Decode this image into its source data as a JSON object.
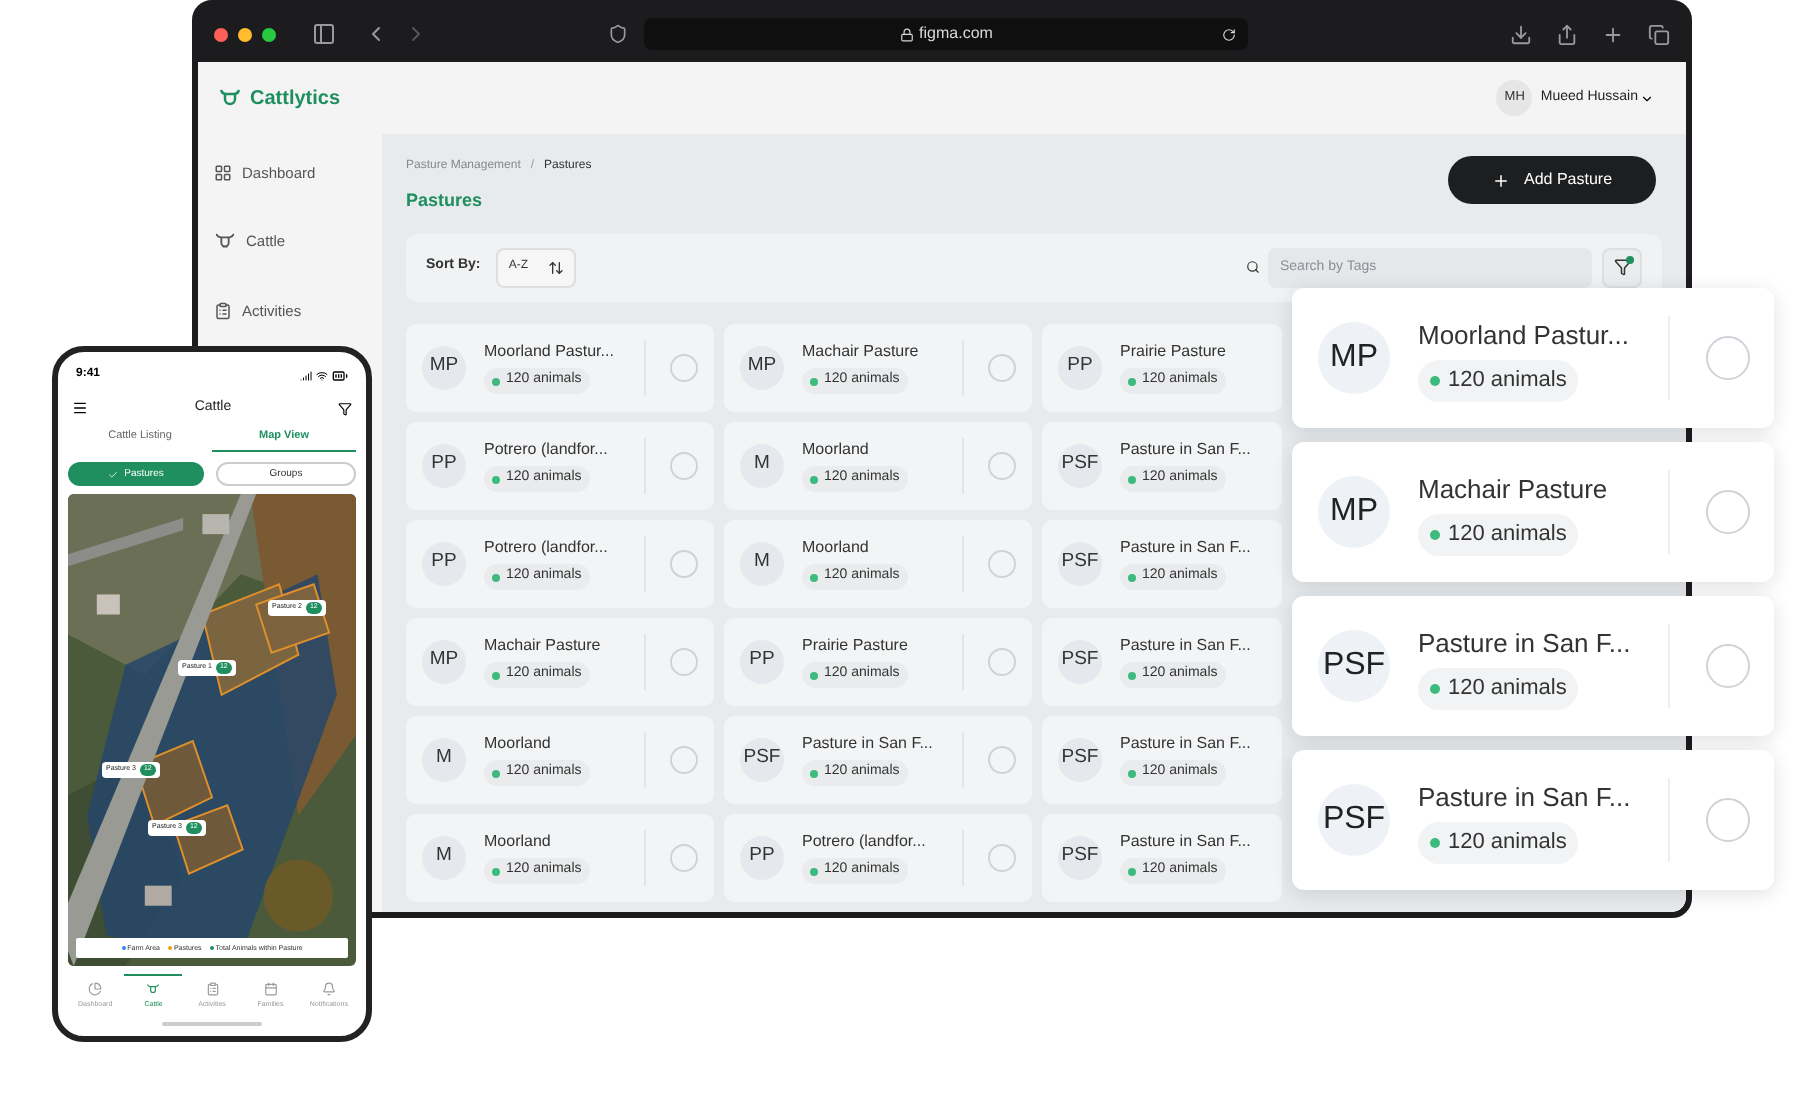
{
  "browser": {
    "url": "figma.com"
  },
  "app": {
    "brand": "Cattlytics",
    "user": {
      "initials": "MH",
      "name": "Mueed Hussain"
    },
    "sidebar": [
      {
        "label": "Dashboard"
      },
      {
        "label": "Cattle"
      },
      {
        "label": "Activities"
      }
    ],
    "breadcrumb": [
      "Pasture Management",
      "Pastures"
    ],
    "breadcrumb_separator": "/",
    "title": "Pastures",
    "add_button": "Add Pasture",
    "sort": {
      "label": "Sort By:",
      "value": "A-Z"
    },
    "search": {
      "placeholder": "Search by Tags"
    },
    "pastures": [
      {
        "initials": "MP",
        "name": "Moorland Pastur...",
        "count": "120 animals",
        "selected": false
      },
      {
        "initials": "MP",
        "name": "Machair Pasture",
        "count": "120 animals",
        "selected": false
      },
      {
        "initials": "PP",
        "name": "Prairie Pasture",
        "count": "120 animals"
      },
      {
        "initials": "PP",
        "name": "Potrero (landfor...",
        "count": "120 animals",
        "selected": false
      },
      {
        "initials": "M",
        "name": "Moorland",
        "count": "120 animals",
        "selected": false
      },
      {
        "initials": "PSF",
        "name": "Pasture in San F...",
        "count": "120 animals"
      },
      {
        "initials": "PP",
        "name": "Potrero (landfor...",
        "count": "120 animals",
        "selected": false
      },
      {
        "initials": "M",
        "name": "Moorland",
        "count": "120 animals",
        "selected": false
      },
      {
        "initials": "PSF",
        "name": "Pasture in San F...",
        "count": "120 animals"
      },
      {
        "initials": "MP",
        "name": "Machair Pasture",
        "count": "120 animals",
        "selected": false
      },
      {
        "initials": "PP",
        "name": "Prairie Pasture",
        "count": "120 animals",
        "selected": false
      },
      {
        "initials": "PSF",
        "name": "Pasture in San F...",
        "count": "120 animals"
      },
      {
        "initials": "M",
        "name": "Moorland",
        "count": "120 animals",
        "selected": false
      },
      {
        "initials": "PSF",
        "name": "Pasture in San F...",
        "count": "120 animals",
        "selected": false
      },
      {
        "initials": "PSF",
        "name": "Pasture in San F...",
        "count": "120 animals"
      },
      {
        "initials": "M",
        "name": "Moorland",
        "count": "120 animals",
        "selected": false
      },
      {
        "initials": "PP",
        "name": "Potrero (landfor...",
        "count": "120 animals",
        "selected": false
      },
      {
        "initials": "PSF",
        "name": "Pasture in San F...",
        "count": "120 animals"
      }
    ]
  },
  "floating_cards": [
    {
      "initials": "MP",
      "name": "Moorland Pastur...",
      "count": "120 animals",
      "selected": false
    },
    {
      "initials": "MP",
      "name": "Machair Pasture",
      "count": "120 animals",
      "selected": false
    },
    {
      "initials": "PSF",
      "name": "Pasture in San F...",
      "count": "120 animals",
      "selected": false
    },
    {
      "initials": "PSF",
      "name": "Pasture in San F...",
      "count": "120 animals",
      "selected": false
    }
  ],
  "phone": {
    "time": "9:41",
    "title": "Cattle",
    "tabs": [
      {
        "label": "Cattle Listing",
        "selected": false
      },
      {
        "label": "Map View",
        "selected": true
      }
    ],
    "chips": [
      {
        "label": "Pastures",
        "selected": true
      },
      {
        "label": "Groups",
        "selected": false
      }
    ],
    "markers": [
      {
        "label": "Pasture 2",
        "count": "12"
      },
      {
        "label": "Pasture 1",
        "count": "12"
      },
      {
        "label": "Pasture 3",
        "count": "12"
      },
      {
        "label": "Pasture 3",
        "count": "12"
      }
    ],
    "legend": [
      {
        "label": "Farm Area",
        "color": "#3b82f6"
      },
      {
        "label": "Pastures",
        "color": "#f59e0b"
      },
      {
        "label": "Total Animals within Pasture",
        "color": "#1f8f5f"
      }
    ],
    "nav": [
      {
        "label": "Dashboard",
        "selected": false
      },
      {
        "label": "Cattle",
        "selected": true
      },
      {
        "label": "Activities",
        "selected": false
      },
      {
        "label": "Families",
        "selected": false
      },
      {
        "label": "Notifications",
        "selected": false
      }
    ]
  }
}
